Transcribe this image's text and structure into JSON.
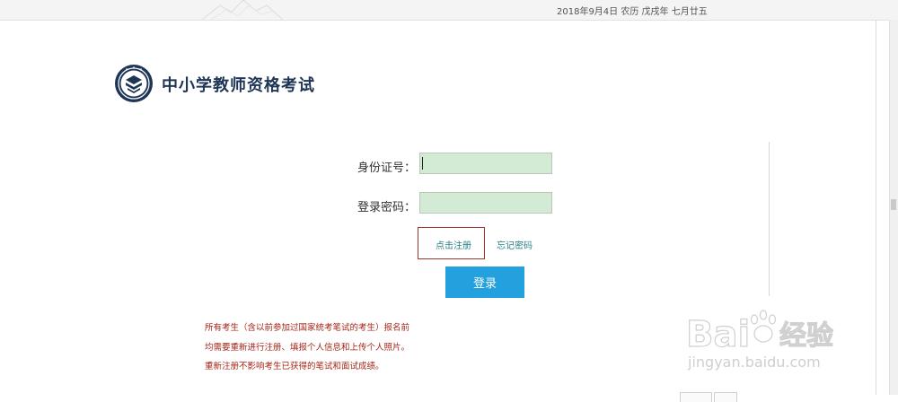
{
  "topbar": {
    "date_text": "2018年9月4日 农历 戊戌年 七月廿五"
  },
  "header": {
    "title": "中小学教师资格考试",
    "logo_icon": "exam-emblem-icon",
    "brand_color": "#1e3556"
  },
  "login_form": {
    "id_label": "身份证号：",
    "id_value": "",
    "password_label": "登录密码：",
    "password_value": "",
    "register_link": "点击注册",
    "forgot_link": "忘记密码",
    "login_button": "登录",
    "input_bg_color": "#d3ebd5",
    "button_color": "#23a0de",
    "link_color": "#2a7f86"
  },
  "notice": {
    "lines": [
      "所有考生（含以前参加过国家统考笔试的考生）报名前",
      "均需要重新进行注册、填报个人信息和上传个人照片。",
      "重新注册不影响考生已获得的笔试和面试成绩。"
    ],
    "color": "#a62617"
  },
  "watermark": {
    "brand": "Bai",
    "brand_suffix": "经验",
    "url": "jingyan.baidu.com"
  }
}
